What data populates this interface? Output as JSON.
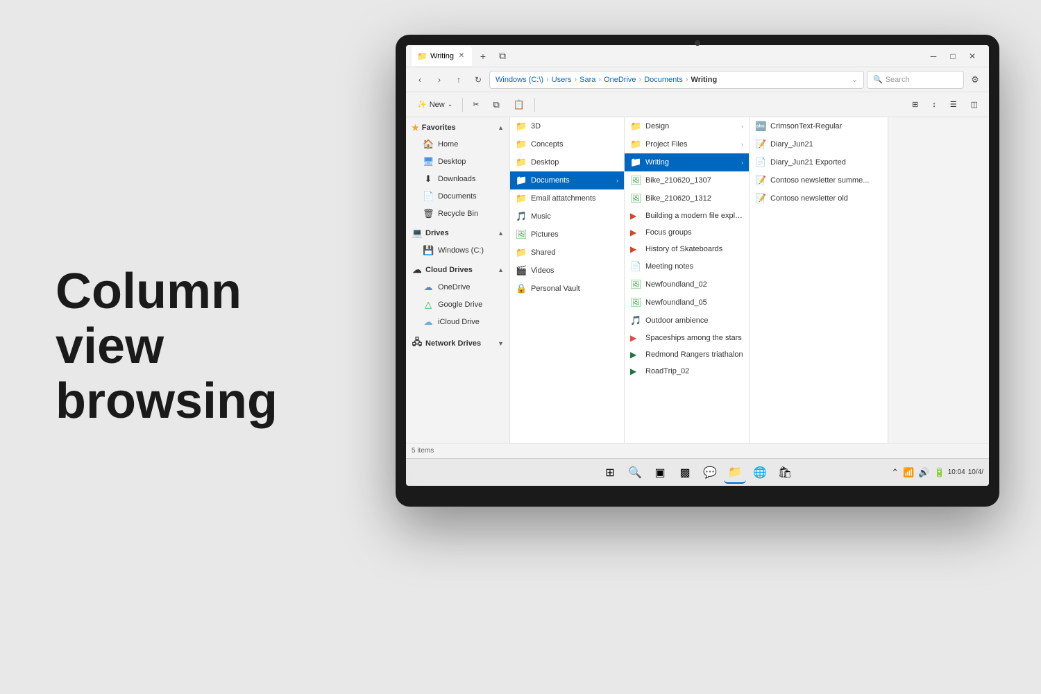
{
  "page": {
    "background_text_line1": "Column",
    "background_text_line2": "view",
    "background_text_line3": "browsing"
  },
  "window": {
    "tab_title": "Writing",
    "tab_icon": "📁"
  },
  "address_bar": {
    "breadcrumb": "Windows (C:\\) > Users > Sara > OneDrive > Documents > Writing",
    "bc_parts": [
      "Windows (C:\\)",
      "Users",
      "Sara",
      "OneDrive",
      "Documents",
      "Writing"
    ],
    "search_placeholder": "Search",
    "chevron_down": "⌄"
  },
  "toolbar": {
    "new_label": "New",
    "new_icon": "➕"
  },
  "sidebar": {
    "favorites_label": "Favorites",
    "items_favorites": [
      {
        "label": "Home",
        "icon": "🏠"
      },
      {
        "label": "Desktop",
        "icon": "🖥️"
      },
      {
        "label": "Downloads",
        "icon": "⬇️"
      },
      {
        "label": "Documents",
        "icon": "📄"
      },
      {
        "label": "Recycle Bin",
        "icon": "🗑️"
      }
    ],
    "drives_label": "Drives",
    "items_drives": [
      {
        "label": "Windows (C:)",
        "icon": "💾"
      }
    ],
    "cloud_drives_label": "Cloud Drives",
    "items_cloud": [
      {
        "label": "OneDrive",
        "icon": "☁️"
      },
      {
        "label": "Google Drive",
        "icon": "△"
      },
      {
        "label": "iCloud Drive",
        "icon": "☁️"
      }
    ],
    "network_label": "Network Drives"
  },
  "columns": {
    "col1_items": [
      {
        "label": "3D",
        "icon": "📁",
        "type": "folder"
      },
      {
        "label": "Concepts",
        "icon": "📁",
        "type": "folder"
      },
      {
        "label": "Desktop",
        "icon": "📁",
        "type": "folder"
      },
      {
        "label": "Documents",
        "icon": "📁",
        "type": "folder",
        "selected": true
      },
      {
        "label": "Email attatchments",
        "icon": "📁",
        "type": "folder"
      },
      {
        "label": "Music",
        "icon": "🎵",
        "type": "folder"
      },
      {
        "label": "Pictures",
        "icon": "🖼️",
        "type": "folder"
      },
      {
        "label": "Shared",
        "icon": "📁",
        "type": "folder"
      },
      {
        "label": "Videos",
        "icon": "🎬",
        "type": "folder"
      },
      {
        "label": "Personal Vault",
        "icon": "🔒",
        "type": "folder"
      }
    ],
    "col2_items": [
      {
        "label": "Design",
        "icon": "📁",
        "type": "folder"
      },
      {
        "label": "Project Files",
        "icon": "📁",
        "type": "folder"
      },
      {
        "label": "Writing",
        "icon": "📁",
        "type": "folder",
        "selected": true
      },
      {
        "label": "Bike_210620_1307",
        "icon": "🖼️",
        "type": "file"
      },
      {
        "label": "Bike_210620_1312",
        "icon": "🖼️",
        "type": "file"
      },
      {
        "label": "Building a modern file explor...",
        "icon": "📊",
        "type": "file"
      },
      {
        "label": "Focus groups",
        "icon": "📊",
        "type": "file"
      },
      {
        "label": "History of Skateboards",
        "icon": "📊",
        "type": "file"
      },
      {
        "label": "Meeting notes",
        "icon": "📄",
        "type": "file"
      },
      {
        "label": "Newfoundland_02",
        "icon": "🖼️",
        "type": "file"
      },
      {
        "label": "Newfoundland_05",
        "icon": "🖼️",
        "type": "file"
      },
      {
        "label": "Outdoor ambience",
        "icon": "🎵",
        "type": "file"
      },
      {
        "label": "Spaceships among the stars",
        "icon": "📊",
        "type": "file"
      },
      {
        "label": "Redmond Rangers triathalon",
        "icon": "📊",
        "type": "file"
      },
      {
        "label": "RoadTrip_02",
        "icon": "📊",
        "type": "file"
      }
    ],
    "col3_items": [
      {
        "label": "CrimsonText-Regular",
        "icon": "🔤",
        "type": "file"
      },
      {
        "label": "Diary_Jun21",
        "icon": "📝",
        "type": "file"
      },
      {
        "label": "Diary_Jun21 Exported",
        "icon": "📄",
        "type": "file"
      },
      {
        "label": "Contoso newsletter summe...",
        "icon": "📝",
        "type": "file"
      },
      {
        "label": "Contoso newsletter old",
        "icon": "📝",
        "type": "file"
      }
    ]
  },
  "status_bar": {
    "item_count": "5 items"
  },
  "taskbar": {
    "time": "10:04",
    "date": "10/4/",
    "buttons": [
      {
        "label": "⊞",
        "name": "start"
      },
      {
        "label": "🔍",
        "name": "search"
      },
      {
        "label": "▣",
        "name": "task-view"
      },
      {
        "label": "⊞",
        "name": "widgets"
      },
      {
        "label": "💬",
        "name": "chat"
      },
      {
        "label": "📁",
        "name": "file-explorer"
      },
      {
        "label": "🌐",
        "name": "edge"
      },
      {
        "label": "🛒",
        "name": "store"
      }
    ]
  }
}
